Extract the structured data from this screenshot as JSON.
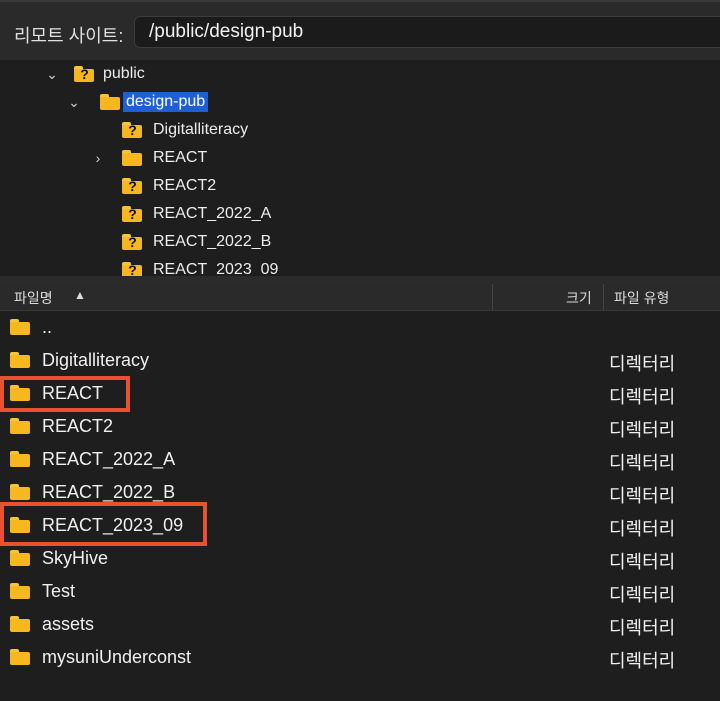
{
  "remote_site": {
    "label": "리모트 사이트:",
    "path": "/public/design-pub"
  },
  "tree": [
    {
      "name": "public",
      "state": "expanded",
      "icon": "folder-question-icon"
    },
    {
      "name": "design-pub",
      "state": "expanded",
      "icon": "folder-icon",
      "selected": true
    },
    {
      "name": "Digitalliteracy",
      "icon": "folder-question-icon"
    },
    {
      "name": "REACT",
      "state": "collapsed",
      "icon": "folder-icon"
    },
    {
      "name": "REACT2",
      "icon": "folder-question-icon"
    },
    {
      "name": "REACT_2022_A",
      "icon": "folder-question-icon"
    },
    {
      "name": "REACT_2022_B",
      "icon": "folder-question-icon"
    },
    {
      "name": "REACT_2023_09",
      "icon": "folder-question-icon"
    }
  ],
  "columns": {
    "name": "파일명",
    "sort_icon": "chevron-up-icon",
    "size": "크기",
    "type": "파일 유형"
  },
  "files": [
    {
      "name": "..",
      "type": ""
    },
    {
      "name": "Digitalliteracy",
      "type": "디렉터리"
    },
    {
      "name": "REACT",
      "type": "디렉터리",
      "highlighted": true
    },
    {
      "name": "REACT2",
      "type": "디렉터리"
    },
    {
      "name": "REACT_2022_A",
      "type": "디렉터리"
    },
    {
      "name": "REACT_2022_B",
      "type": "디렉터리"
    },
    {
      "name": "REACT_2023_09",
      "type": "디렉터리",
      "highlighted": true
    },
    {
      "name": "SkyHive",
      "type": "디렉터리"
    },
    {
      "name": "Test",
      "type": "디렉터리"
    },
    {
      "name": "assets",
      "type": "디렉터리"
    },
    {
      "name": "mysuniUnderconst",
      "type": "디렉터리"
    }
  ],
  "colors": {
    "folder": "#f7b81f",
    "selection": "#1f5fd6",
    "highlight_box": "#e8522f"
  }
}
